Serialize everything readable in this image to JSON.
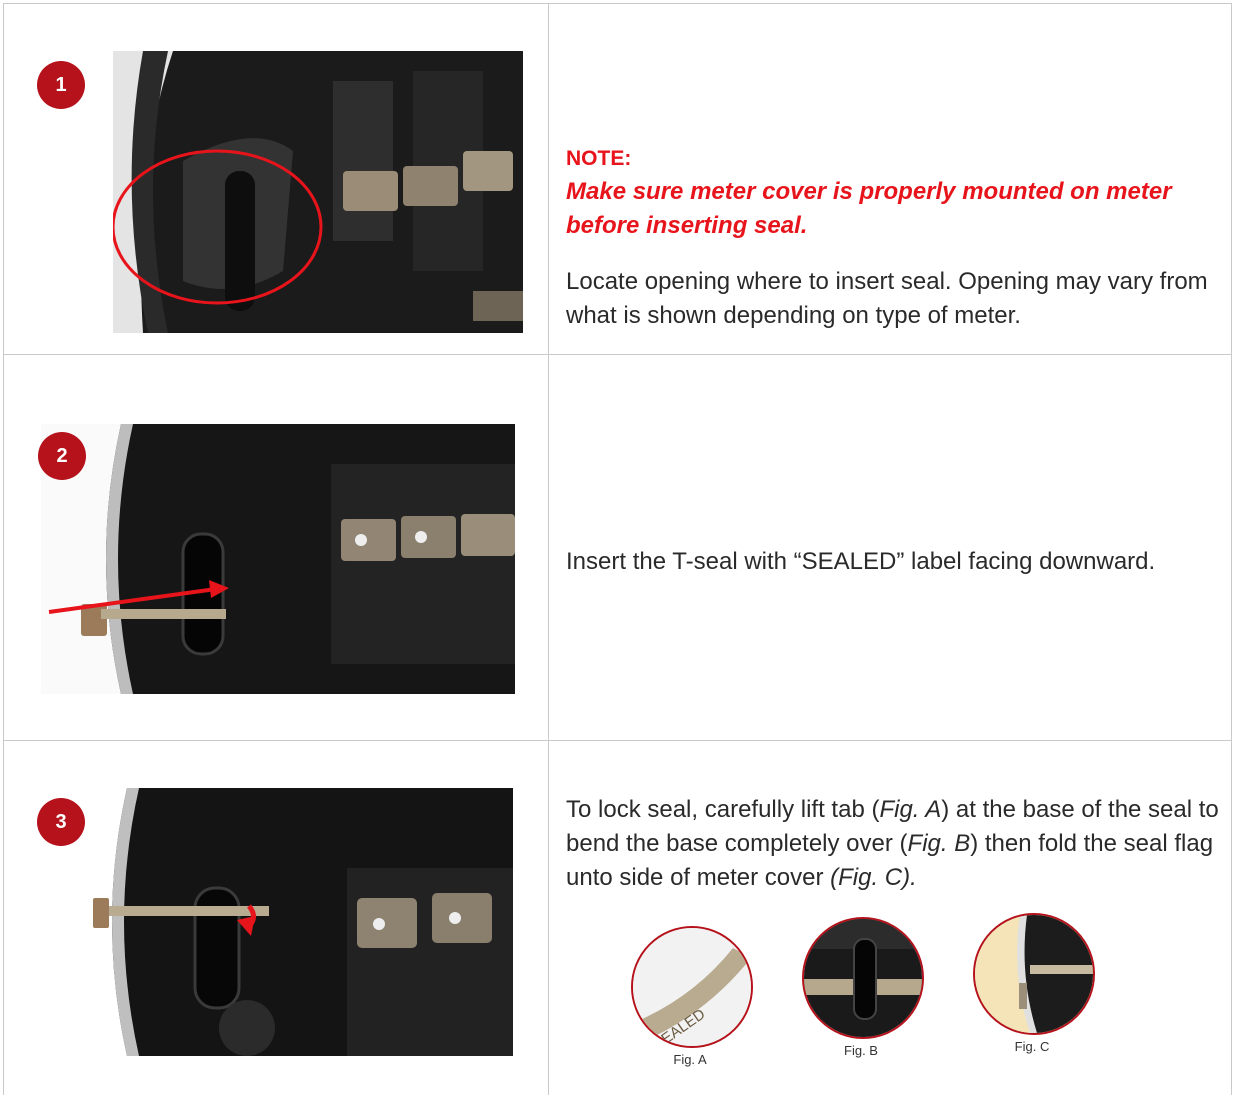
{
  "steps": [
    {
      "number": "1",
      "note_title": "NOTE:",
      "note_body": "Make sure meter cover is properly mounted on meter before inserting seal.",
      "text": "Locate opening where to insert seal. Opening may vary from what is shown depending on type of meter."
    },
    {
      "number": "2",
      "text": "Insert the T-seal with “SEALED” label facing downward."
    },
    {
      "number": "3",
      "text_part1": "To lock seal, carefully lift tab (",
      "fig_a_ref": "Fig. A",
      "text_part2": ") at the base of the seal to bend the base completely over (",
      "fig_b_ref": "Fig. B",
      "text_part3": ") then fold the seal flag unto side of meter cover ",
      "fig_c_ref": "(Fig. C).",
      "figures": [
        {
          "label": "Fig. A",
          "seal_text": "SEALED"
        },
        {
          "label": "Fig. B"
        },
        {
          "label": "Fig. C"
        }
      ]
    }
  ],
  "colors": {
    "badge": "#b5121b",
    "note": "#e8141b",
    "arrow": "#e8141b",
    "border": "#c9c9c9"
  }
}
